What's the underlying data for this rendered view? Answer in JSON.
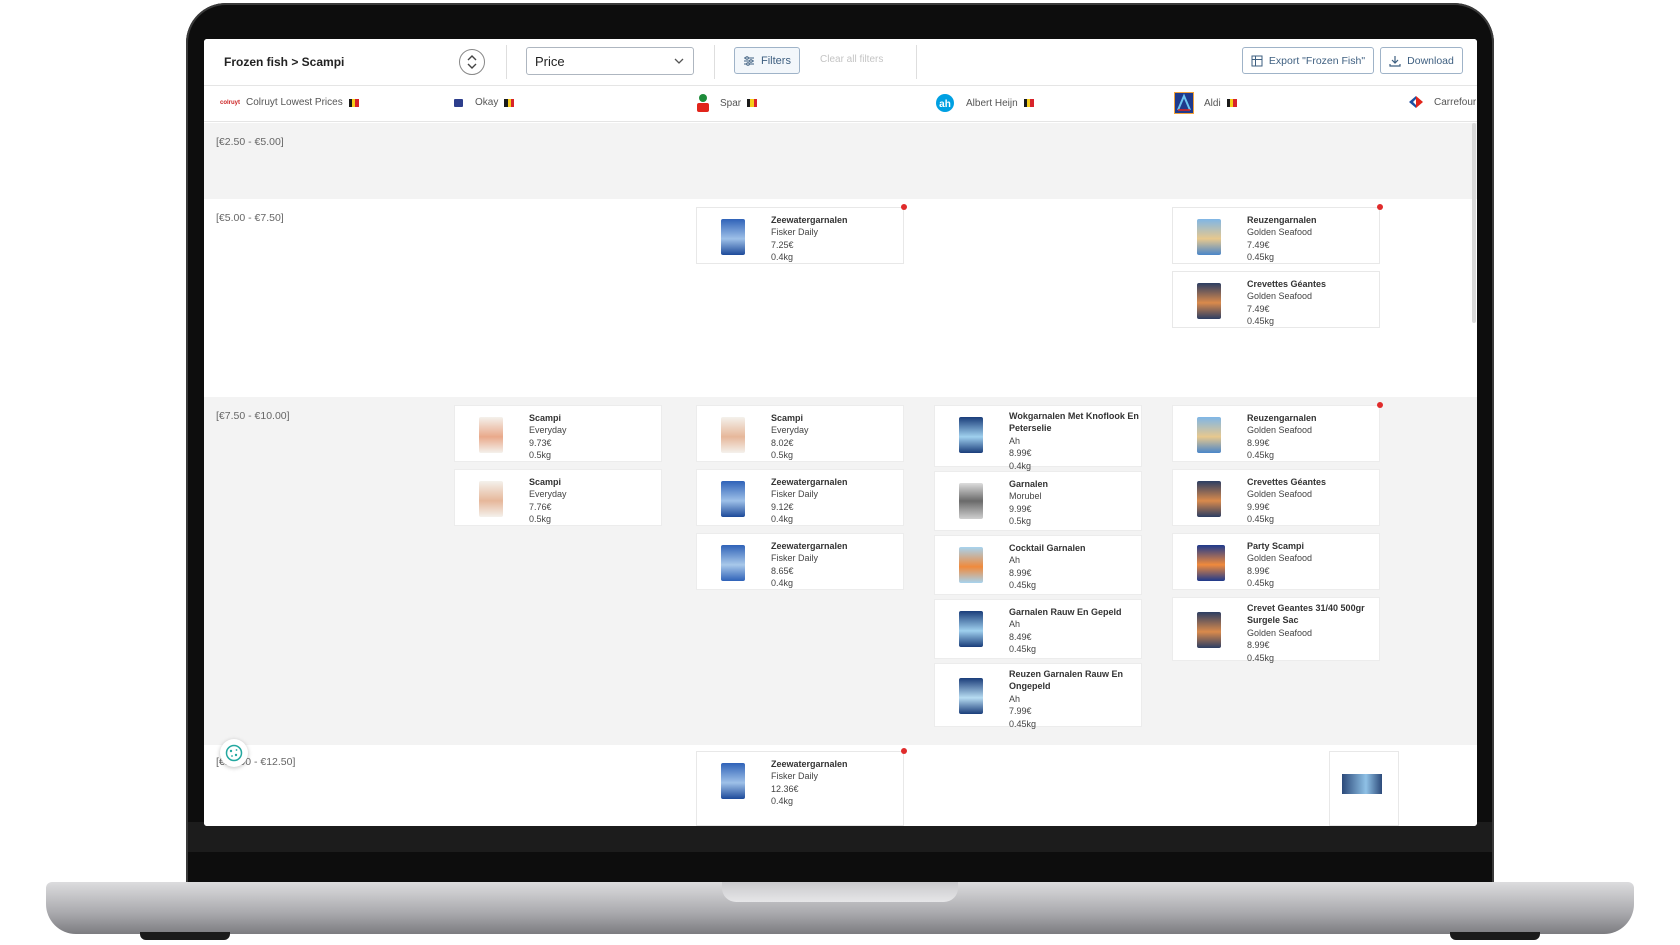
{
  "toolbar": {
    "breadcrumb": "Frozen fish > Scampi",
    "sort_select_value": "Price",
    "filters_label": "Filters",
    "clear_label": "Clear all filters",
    "export_label": "Export \"Frozen Fish\"",
    "download_label": "Download"
  },
  "stores": [
    {
      "name": "Colruyt Lowest Prices",
      "logo_text": "colruyt"
    },
    {
      "name": "Okay"
    },
    {
      "name": "Spar"
    },
    {
      "name": "Albert Heijn"
    },
    {
      "name": "Aldi"
    },
    {
      "name": "Carrefour"
    }
  ],
  "ranges": [
    "[€2.50 - €5.00]",
    "[€5.00 - €7.50]",
    "[€7.50 - €10.00]",
    "[€10.00 - €12.50]"
  ],
  "colors": {
    "accent": "#3e5f80",
    "alert_dot": "#e02b2b",
    "flag_black": "#1a1a1a",
    "flag_yellow": "#f5cd1a",
    "flag_red": "#d8232a"
  },
  "products": {
    "r2": {
      "spar": [
        {
          "name": "Zeewatergarnalen",
          "brand": "Fisker Daily",
          "price": "7.25€",
          "weight": "0.4kg"
        }
      ],
      "aldi": [
        {
          "name": "Reuzengarnalen",
          "brand": "Golden Seafood",
          "price": "7.49€",
          "weight": "0.45kg"
        },
        {
          "name": "Crevettes Géantes",
          "brand": "Golden Seafood",
          "price": "7.49€",
          "weight": "0.45kg"
        }
      ]
    },
    "r3": {
      "okay": [
        {
          "name": "Scampi",
          "brand": "Everyday",
          "price": "9.73€",
          "weight": "0.5kg"
        },
        {
          "name": "Scampi",
          "brand": "Everyday",
          "price": "7.76€",
          "weight": "0.5kg"
        }
      ],
      "spar": [
        {
          "name": "Scampi",
          "brand": "Everyday",
          "price": "8.02€",
          "weight": "0.5kg"
        },
        {
          "name": "Zeewatergarnalen",
          "brand": "Fisker Daily",
          "price": "9.12€",
          "weight": "0.4kg"
        },
        {
          "name": "Zeewatergarnalen",
          "brand": "Fisker Daily",
          "price": "8.65€",
          "weight": "0.4kg"
        }
      ],
      "ah": [
        {
          "name": "Wokgarnalen Met Knoflook En Peterselie",
          "brand": "Ah",
          "price": "8.99€",
          "weight": "0.4kg"
        },
        {
          "name": "Garnalen",
          "brand": "Morubel",
          "price": "9.99€",
          "weight": "0.5kg"
        },
        {
          "name": "Cocktail Garnalen",
          "brand": "Ah",
          "price": "8.99€",
          "weight": "0.45kg"
        },
        {
          "name": "Garnalen Rauw En Gepeld",
          "brand": "Ah",
          "price": "8.49€",
          "weight": "0.45kg"
        },
        {
          "name": "Reuzen Garnalen Rauw En Ongepeld",
          "brand": "Ah",
          "price": "7.99€",
          "weight": "0.45kg"
        }
      ],
      "aldi": [
        {
          "name": "Reuzengarnalen",
          "brand": "Golden Seafood",
          "price": "8.99€",
          "weight": "0.45kg"
        },
        {
          "name": "Crevettes Géantes",
          "brand": "Golden Seafood",
          "price": "9.99€",
          "weight": "0.45kg"
        },
        {
          "name": "Party Scampi",
          "brand": "Golden Seafood",
          "price": "8.99€",
          "weight": "0.45kg"
        },
        {
          "name": "Crevet Geantes 31/40 500gr Surgele Sac",
          "brand": "Golden Seafood",
          "price": "8.99€",
          "weight": "0.45kg"
        }
      ]
    },
    "r4": {
      "spar": [
        {
          "name": "Zeewatergarnalen",
          "brand": "Fisker Daily",
          "price": "12.36€",
          "weight": "0.4kg"
        }
      ]
    }
  }
}
